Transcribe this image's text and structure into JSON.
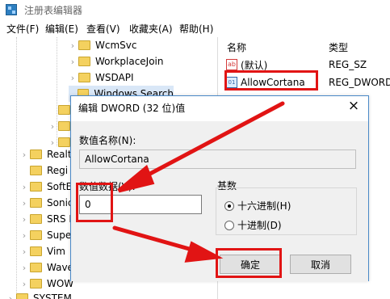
{
  "window": {
    "title": "注册表编辑器"
  },
  "menu": [
    "文件(F)",
    "编辑(E)",
    "查看(V)",
    "收藏夹(A)",
    "帮助(H)"
  ],
  "tree": {
    "items": [
      {
        "label": "WcmSvc"
      },
      {
        "label": "WorkplaceJoin"
      },
      {
        "label": "WSDAPI"
      },
      {
        "label": "Windows Search",
        "selected": true
      },
      {
        "label": "Realt"
      },
      {
        "label": "Regi"
      },
      {
        "label": "SoftE"
      },
      {
        "label": "Sonic"
      },
      {
        "label": "SRS L"
      },
      {
        "label": "Supe"
      },
      {
        "label": "Vim"
      },
      {
        "label": "Wave"
      },
      {
        "label": "WOW"
      },
      {
        "label": "SYSTEM"
      }
    ]
  },
  "values": {
    "columns": {
      "name": "名称",
      "type": "类型"
    },
    "rows": [
      {
        "name": "(默认)",
        "type": "REG_SZ",
        "icon": "string-value-icon"
      },
      {
        "name": "AllowCortana",
        "type": "REG_DWORD",
        "icon": "dword-value-icon"
      }
    ]
  },
  "dialog": {
    "title": "编辑 DWORD (32 位)值",
    "close": "×",
    "value_name_label": "数值名称(N):",
    "value_name": "AllowCortana",
    "value_data_label": "数值数据(V):",
    "value_data": "0",
    "base_label": "基数",
    "hex_label": "十六进制(H)",
    "dec_label": "十进制(D)",
    "ok_label": "确定",
    "cancel_label": "取消"
  },
  "colors": {
    "highlight": "#e11414",
    "selected": "#d9e7f7",
    "accent": "#4a89c7"
  }
}
